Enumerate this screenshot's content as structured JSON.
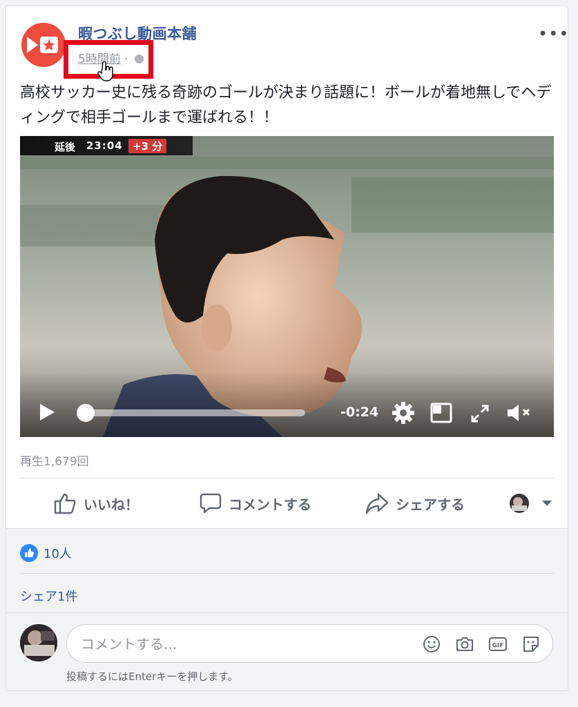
{
  "post": {
    "page_name": "暇つぶし動画本舗",
    "timestamp": "5時間前",
    "separator": "·",
    "more_label": "•••",
    "text": "高校サッカー史に残る奇跡のゴールが決まり話題に！ボールが着地無しでヘディングで相手ゴールまで運ばれる！！"
  },
  "video": {
    "scoreboard_label": "延後",
    "scoreboard_time": "23:04",
    "scoreboard_extra": "+3 分",
    "remaining_time": "-0:24",
    "progress": 0.02
  },
  "views": "再生1,679回",
  "actions": {
    "like": "いいね！",
    "comment": "コメントする",
    "share": "シェアする"
  },
  "reactions": {
    "likes": "10人"
  },
  "shares": "シェア1件",
  "comment": {
    "placeholder": "コメントする...",
    "hint": "投稿するにはEnterキーを押します。"
  },
  "colors": {
    "highlight": "#e3091c",
    "link": "#385898",
    "like_badge": "#2d88ff"
  }
}
